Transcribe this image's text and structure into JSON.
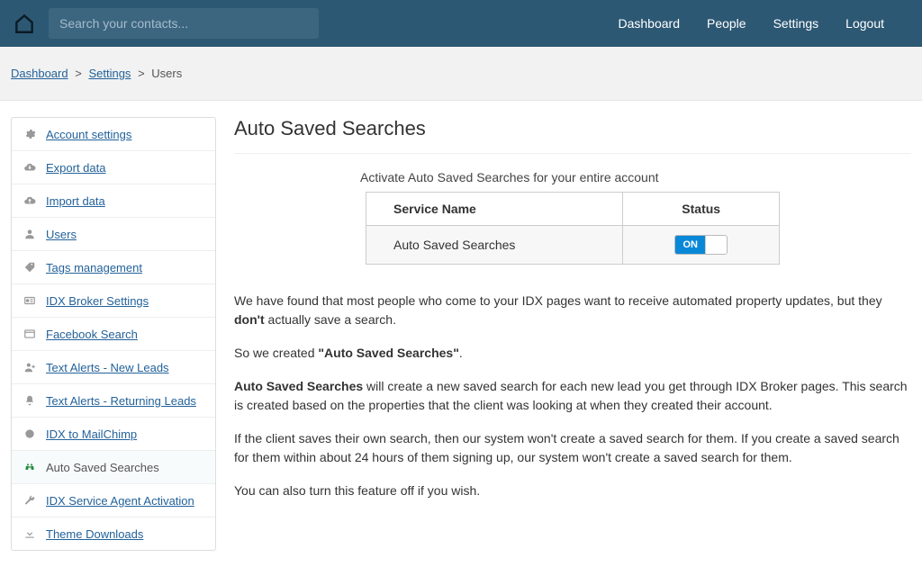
{
  "header": {
    "search_placeholder": "Search your contacts...",
    "nav": [
      {
        "label": "Dashboard"
      },
      {
        "label": "People"
      },
      {
        "label": "Settings"
      },
      {
        "label": "Logout"
      }
    ]
  },
  "breadcrumb": {
    "items": [
      {
        "label": "Dashboard",
        "link": true
      },
      {
        "label": "Settings",
        "link": true
      },
      {
        "label": "Users",
        "link": false
      }
    ]
  },
  "sidebar": {
    "items": [
      {
        "icon": "gear",
        "label": "Account settings",
        "active": false
      },
      {
        "icon": "cloud-download",
        "label": "Export data",
        "active": false
      },
      {
        "icon": "cloud-upload",
        "label": "Import data",
        "active": false
      },
      {
        "icon": "user",
        "label": "Users",
        "active": false
      },
      {
        "icon": "tags",
        "label": "Tags management",
        "active": false
      },
      {
        "icon": "id-card",
        "label": "IDX Broker Settings",
        "active": false
      },
      {
        "icon": "facebook",
        "label": "Facebook Search",
        "active": false
      },
      {
        "icon": "user-plus",
        "label": "Text Alerts - New Leads",
        "active": false
      },
      {
        "icon": "bell",
        "label": "Text Alerts - Returning Leads",
        "active": false
      },
      {
        "icon": "mailchimp",
        "label": "IDX to MailChimp",
        "active": false
      },
      {
        "icon": "binoculars",
        "label": "Auto Saved Searches",
        "active": true
      },
      {
        "icon": "wrench",
        "label": "IDX Service Agent Activation",
        "active": false
      },
      {
        "icon": "download",
        "label": "Theme Downloads",
        "active": false
      }
    ]
  },
  "main": {
    "title": "Auto Saved Searches",
    "activate_text": "Activate Auto Saved Searches for your entire account",
    "table": {
      "col1": "Service Name",
      "col2": "Status",
      "row_service": "Auto Saved Searches",
      "toggle_label": "ON"
    },
    "paragraphs": {
      "p1a": "We have found that most people who come to your IDX pages want to receive automated property updates, but they ",
      "p1b": "don't",
      "p1c": " actually save a search.",
      "p2a": "So we created ",
      "p2b": "\"Auto Saved Searches\"",
      "p2c": ".",
      "p3a": "Auto Saved Searches",
      "p3b": " will create a new saved search for each new lead you get through IDX Broker pages. This search is created based on the properties that the client was looking at when they created their account.",
      "p4": "If the client saves their own search, then our system won't create a saved search for them. If you create a saved search for them within about 24 hours of them signing up, our system won't create a saved search for them.",
      "p5": "You can also turn this feature off if you wish."
    }
  }
}
